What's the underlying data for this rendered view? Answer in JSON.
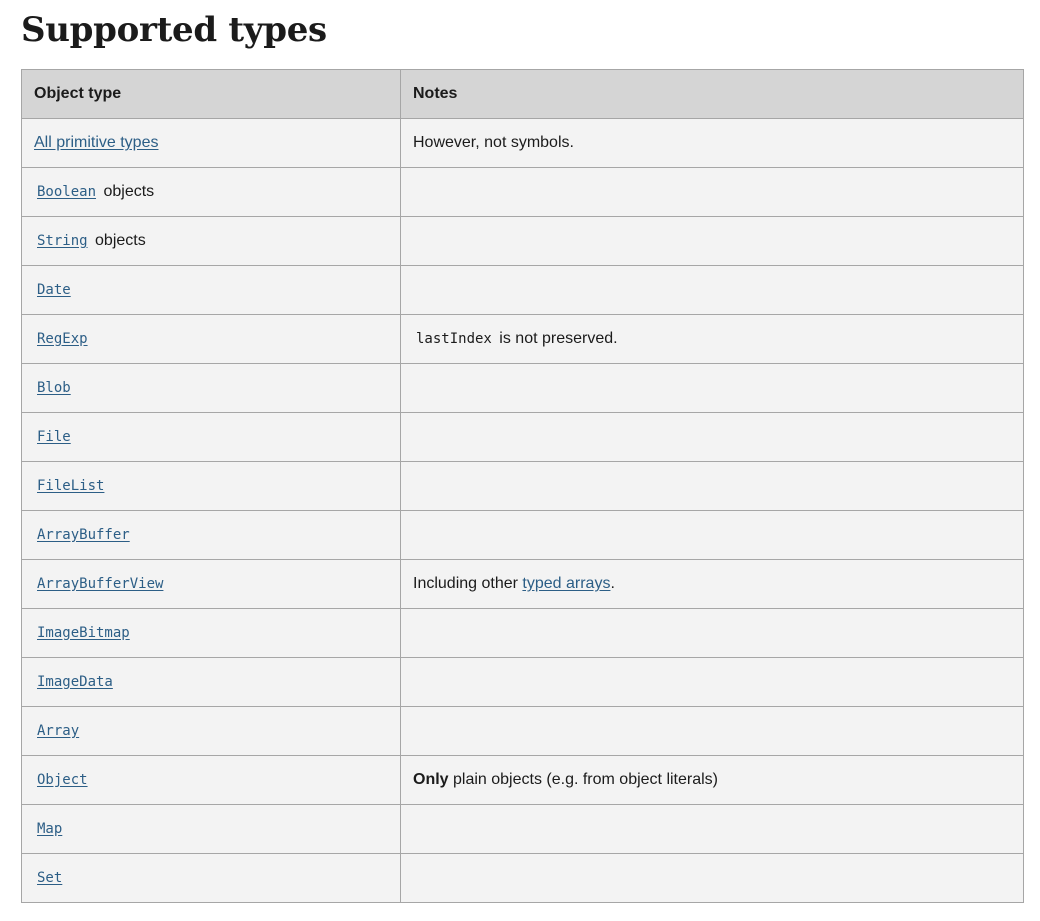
{
  "page": {
    "title": "Supported types"
  },
  "table": {
    "headers": {
      "type": "Object type",
      "notes": "Notes"
    },
    "rows": [
      {
        "type_link": "All primitive types",
        "type_is_code": false,
        "type_suffix": "",
        "notes": {
          "prefix_code": "",
          "bold": "",
          "text": "However, not symbols.",
          "link": "",
          "after_link": ""
        }
      },
      {
        "type_link": "Boolean",
        "type_is_code": true,
        "type_suffix": " objects",
        "notes": {
          "prefix_code": "",
          "bold": "",
          "text": "",
          "link": "",
          "after_link": ""
        }
      },
      {
        "type_link": "String",
        "type_is_code": true,
        "type_suffix": " objects",
        "notes": {
          "prefix_code": "",
          "bold": "",
          "text": "",
          "link": "",
          "after_link": ""
        }
      },
      {
        "type_link": "Date",
        "type_is_code": true,
        "type_suffix": "",
        "notes": {
          "prefix_code": "",
          "bold": "",
          "text": "",
          "link": "",
          "after_link": ""
        }
      },
      {
        "type_link": "RegExp",
        "type_is_code": true,
        "type_suffix": "",
        "notes": {
          "prefix_code": "lastIndex",
          "bold": "",
          "text": " is not preserved.",
          "link": "",
          "after_link": ""
        }
      },
      {
        "type_link": "Blob",
        "type_is_code": true,
        "type_suffix": "",
        "notes": {
          "prefix_code": "",
          "bold": "",
          "text": "",
          "link": "",
          "after_link": ""
        }
      },
      {
        "type_link": "File",
        "type_is_code": true,
        "type_suffix": "",
        "notes": {
          "prefix_code": "",
          "bold": "",
          "text": "",
          "link": "",
          "after_link": ""
        }
      },
      {
        "type_link": "FileList",
        "type_is_code": true,
        "type_suffix": "",
        "notes": {
          "prefix_code": "",
          "bold": "",
          "text": "",
          "link": "",
          "after_link": ""
        }
      },
      {
        "type_link": "ArrayBuffer",
        "type_is_code": true,
        "type_suffix": "",
        "notes": {
          "prefix_code": "",
          "bold": "",
          "text": "",
          "link": "",
          "after_link": ""
        }
      },
      {
        "type_link": "ArrayBufferView",
        "type_is_code": true,
        "type_suffix": "",
        "notes": {
          "prefix_code": "",
          "bold": "",
          "text": "Including other ",
          "link": "typed arrays",
          "after_link": "."
        }
      },
      {
        "type_link": "ImageBitmap",
        "type_is_code": true,
        "type_suffix": "",
        "notes": {
          "prefix_code": "",
          "bold": "",
          "text": "",
          "link": "",
          "after_link": ""
        }
      },
      {
        "type_link": "ImageData",
        "type_is_code": true,
        "type_suffix": "",
        "notes": {
          "prefix_code": "",
          "bold": "",
          "text": "",
          "link": "",
          "after_link": ""
        }
      },
      {
        "type_link": "Array",
        "type_is_code": true,
        "type_suffix": "",
        "notes": {
          "prefix_code": "",
          "bold": "",
          "text": "",
          "link": "",
          "after_link": ""
        }
      },
      {
        "type_link": "Object",
        "type_is_code": true,
        "type_suffix": "",
        "notes": {
          "prefix_code": "",
          "bold": "Only",
          "text": " plain objects (e.g. from object literals)",
          "link": "",
          "after_link": ""
        }
      },
      {
        "type_link": "Map",
        "type_is_code": true,
        "type_suffix": "",
        "notes": {
          "prefix_code": "",
          "bold": "",
          "text": "",
          "link": "",
          "after_link": ""
        }
      },
      {
        "type_link": "Set",
        "type_is_code": true,
        "type_suffix": "",
        "notes": {
          "prefix_code": "",
          "bold": "",
          "text": "",
          "link": "",
          "after_link": ""
        }
      }
    ]
  }
}
